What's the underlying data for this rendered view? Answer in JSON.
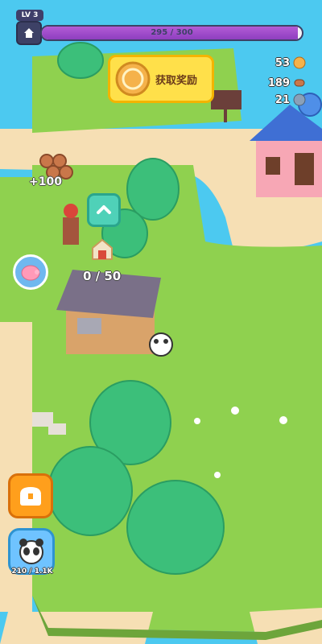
{
  "player": {
    "level_label": "LV 3"
  },
  "xp": {
    "text": "295 / 300",
    "fraction": 0.983
  },
  "reward": {
    "label": "获取奖励"
  },
  "resources": {
    "coins": "53",
    "wood": "189",
    "stone": "21"
  },
  "floating": {
    "wood_gain": "+100",
    "storage": "0 / 50"
  },
  "panda": {
    "count": "210 / 1.1K"
  },
  "colors": {
    "water": "#4cc9f0",
    "grass": "#8fd14f",
    "sand": "#f6dfb4",
    "xp": "#9b4fd0",
    "reward": "#ffe04a"
  }
}
